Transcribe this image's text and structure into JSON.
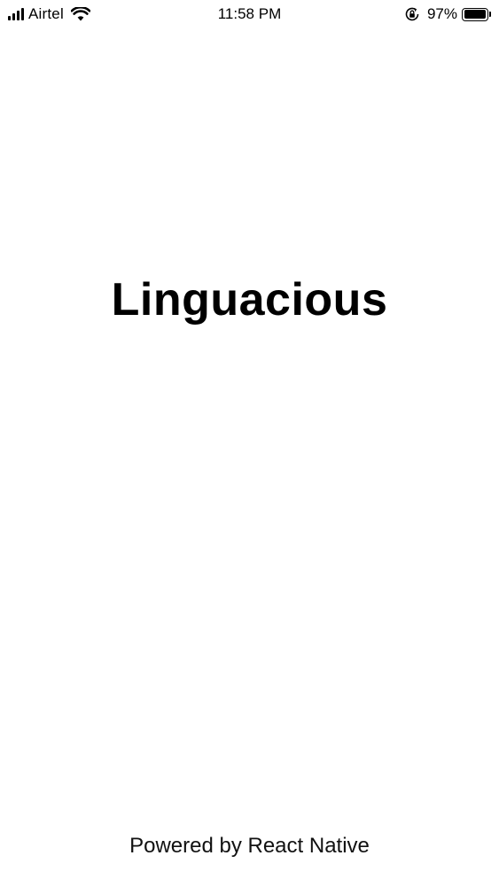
{
  "status_bar": {
    "carrier": "Airtel",
    "signal_bars": 4,
    "time": "11:58 PM",
    "battery_percent_label": "97%",
    "battery_level": 0.97,
    "icons": [
      "signal-icon",
      "wifi-icon",
      "orientation-lock-icon",
      "battery-icon"
    ]
  },
  "main": {
    "title": "Linguacious"
  },
  "footer": {
    "text": "Powered by React Native"
  },
  "colors": {
    "background": "#ffffff",
    "text": "#000000"
  }
}
